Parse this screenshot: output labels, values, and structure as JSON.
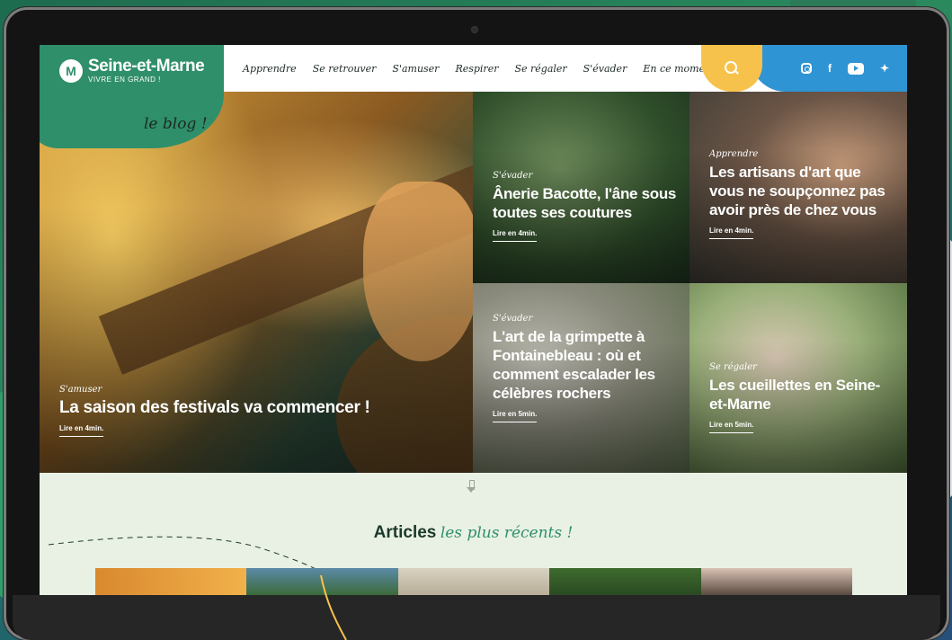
{
  "header": {
    "logo_name": "Seine-et-Marne",
    "logo_tagline": "VIVRE EN GRAND !",
    "blog_label": "le blog !",
    "nav": [
      "Apprendre",
      "Se retrouver",
      "S'amuser",
      "Respirer",
      "Se régaler",
      "S'évader",
      "En ce moment"
    ],
    "social": [
      "instagram-icon",
      "facebook-icon",
      "youtube-icon",
      "twitter-icon"
    ]
  },
  "hero": {
    "main": {
      "category": "S'amuser",
      "title": "La saison des festivals va commencer !",
      "read": "Lire en 4min."
    },
    "cards": [
      {
        "category": "S'évader",
        "title": "Ânerie Bacotte, l'âne sous toutes ses coutures",
        "read": "Lire en 4min."
      },
      {
        "category": "Apprendre",
        "title": "Les artisans d'art que vous ne soupçonnez pas avoir près de chez vous",
        "read": "Lire en 4min."
      },
      {
        "category": "S'évader",
        "title": "L'art de la grimpette à Fontainebleau : où et comment escalader les célèbres rochers",
        "read": "Lire en 5min."
      },
      {
        "category": "Se régaler",
        "title": "Les cueillettes en Seine-et-Marne",
        "read": "Lire en 5min."
      }
    ]
  },
  "recent": {
    "title_bold": "Articles",
    "title_script": "les plus récents !"
  },
  "colors": {
    "brand_green": "#2f8f6a",
    "search_yellow": "#f7c24b",
    "social_blue": "#2f94d3"
  }
}
